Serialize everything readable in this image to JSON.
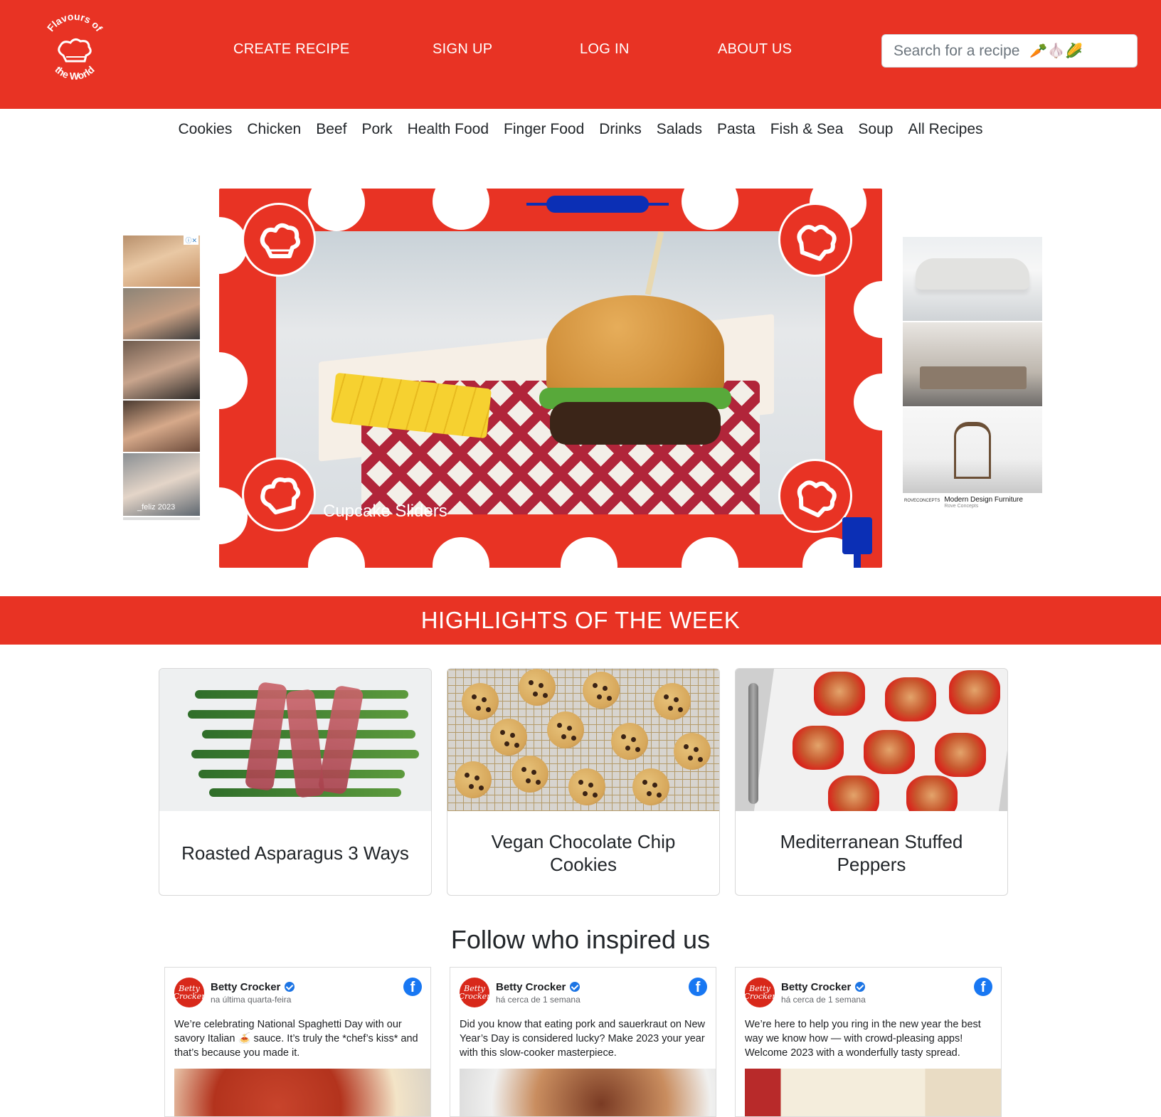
{
  "colors": {
    "brand_red": "#e83324",
    "white": "#ffffff",
    "facebook_blue": "#1877f2"
  },
  "header": {
    "logo": {
      "top_text": "Flavours of",
      "bottom_text": "the World",
      "icon": "chef-hat-icon"
    },
    "nav": [
      {
        "label": "CREATE RECIPE"
      },
      {
        "label": "SIGN UP"
      },
      {
        "label": "LOG IN"
      },
      {
        "label": "ABOUT US"
      }
    ],
    "search": {
      "placeholder": "Search for a recipe",
      "emoji": "🥕🧄🌽"
    }
  },
  "categories": [
    "Cookies",
    "Chicken",
    "Beef",
    "Pork",
    "Health Food",
    "Finger Food",
    "Drinks",
    "Salads",
    "Pasta",
    "Fish & Sea",
    "Soup",
    "All Recipes"
  ],
  "ads": {
    "left": {
      "caption": "_feliz 2023",
      "badge": "ⓘ✕"
    },
    "right": {
      "badge": "ⓘ ✕",
      "brand": "ROVECONCEPTS",
      "title": "Modern Design Furniture",
      "subtitle": "Rove Concepts"
    }
  },
  "hero": {
    "caption": "Cupcake Sliders"
  },
  "highlights": {
    "heading": "HIGHLIGHTS OF THE WEEK",
    "cards": [
      {
        "title": "Roasted Asparagus 3 Ways"
      },
      {
        "title": "Vegan Chocolate Chip Cookies"
      },
      {
        "title": "Mediterranean Stuffed Peppers"
      }
    ]
  },
  "follow": {
    "heading": "Follow who inspired us",
    "posts": [
      {
        "avatar": "Betty Crocker",
        "name": "Betty Crocker",
        "time": "na última quarta-feira",
        "text": "We’re celebrating National Spaghetti Day with our savory Italian 🍝 sauce. It’s truly the *chef’s kiss* and that’s because you made it."
      },
      {
        "avatar": "Betty Crocker",
        "name": "Betty Crocker",
        "time": "há cerca de 1 semana",
        "text": "Did you know that eating pork and sauerkraut on New Year’s Day is considered lucky? Make 2023 your year with this slow-cooker masterpiece."
      },
      {
        "avatar": "Betty Crocker",
        "name": "Betty Crocker",
        "time": "há cerca de 1 semana",
        "text": "We’re here to help you ring in the new year the best way we know how — with crowd-pleasing apps! Welcome 2023 with a wonderfully tasty spread."
      }
    ]
  }
}
